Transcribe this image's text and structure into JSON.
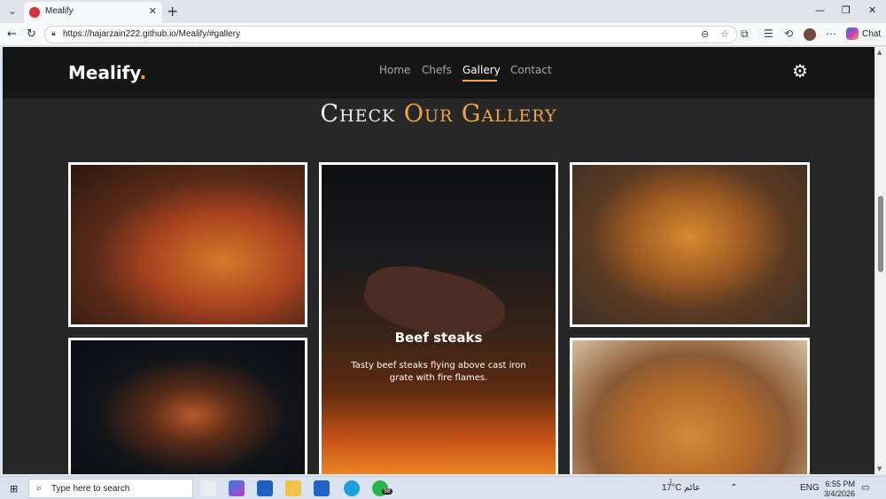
{
  "browser": {
    "tab_title": "Mealify",
    "url": "https://hajarzain222.github.io/Mealify/#gallery",
    "chat_label": "Chat"
  },
  "site": {
    "logo": "Mealify",
    "logo_dot": ".",
    "nav": [
      "Home",
      "Chefs",
      "Gallery",
      "Contact"
    ],
    "active_nav": "Gallery",
    "gallery_title_1": "Check",
    "gallery_title_2": "Our Gallery",
    "featured": {
      "title": "Beef steaks",
      "description": "Tasty beef steaks flying above cast iron grate with fire flames."
    }
  },
  "taskbar": {
    "search_placeholder": "Type here to search",
    "weather": "17°C عائم",
    "weather_alert": "1",
    "whatsapp_badge": "98",
    "lang": "ENG",
    "time": "6:55 PM",
    "date": "3/4/2026"
  },
  "colors": {
    "accent": "#f3a63b",
    "page_bg": "#272727",
    "header_bg": "#161616"
  },
  "icons": [
    "chevron-down-icon",
    "tab-favicon",
    "close-icon",
    "plus-icon",
    "back-icon",
    "refresh-icon",
    "lock-icon",
    "read-aloud-icon",
    "star-icon",
    "extensions-icon",
    "favorites-icon",
    "history-icon",
    "more-icon",
    "gear-icon",
    "windows-icon",
    "search-icon"
  ]
}
